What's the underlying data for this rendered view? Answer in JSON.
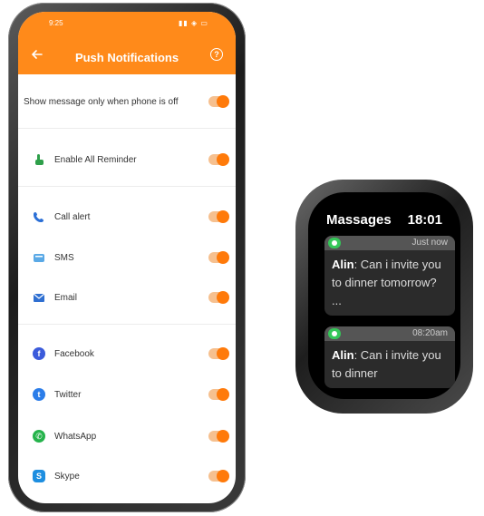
{
  "phone": {
    "status_time": "9:25",
    "status_icons": "▮▮ ◈ ▭",
    "title": "Push Notifications",
    "rows": [
      {
        "label": "Show message only when phone is off",
        "icon": "none"
      },
      {
        "label": "Enable All Reminder",
        "icon": "hand-tap-icon"
      },
      {
        "label": "Call alert",
        "icon": "phone-icon"
      },
      {
        "label": "SMS",
        "icon": "sms-icon"
      },
      {
        "label": "Email",
        "icon": "email-icon"
      },
      {
        "label": "Facebook",
        "icon": "facebook-icon"
      },
      {
        "label": "Twitter",
        "icon": "twitter-icon"
      },
      {
        "label": "WhatsApp",
        "icon": "whatsapp-icon"
      },
      {
        "label": "Skype",
        "icon": "skype-icon"
      }
    ],
    "accent_color": "#ff8a1a"
  },
  "watch": {
    "title": "Massages",
    "time": "18:01",
    "cards": [
      {
        "time": "Just now",
        "sender": "Alin",
        "text": "Can i invite you to dinner tomorrow? ..."
      },
      {
        "time": "08:20am",
        "sender": "Alin",
        "text": "Can i invite you to dinner"
      }
    ]
  }
}
